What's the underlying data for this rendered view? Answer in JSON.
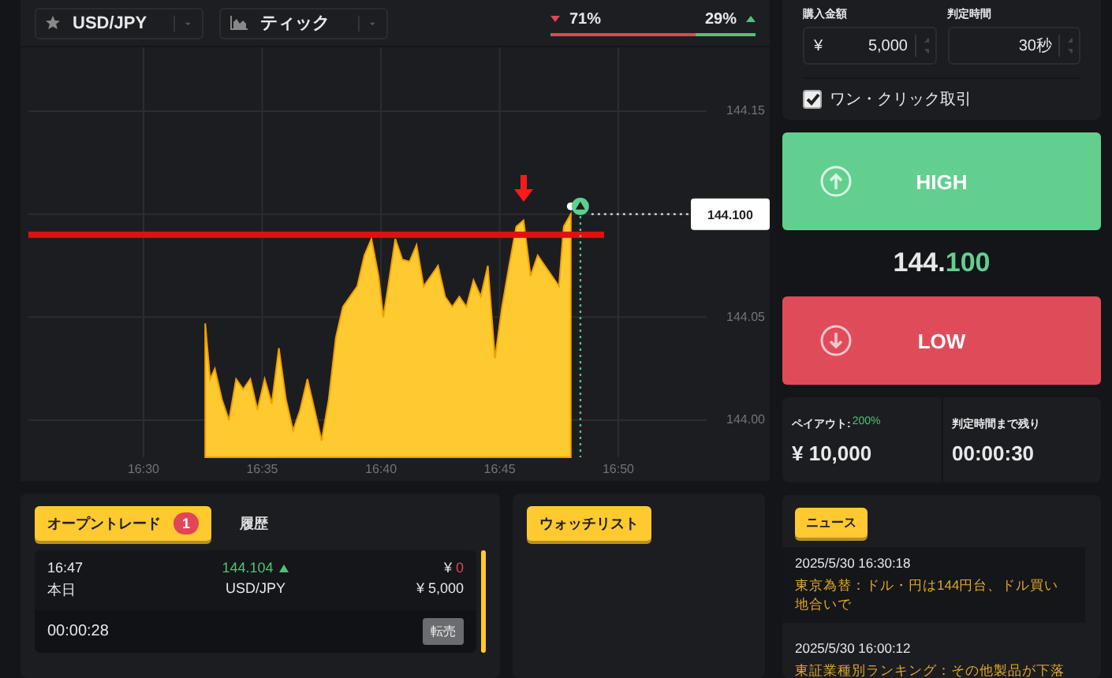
{
  "toolbar": {
    "symbol": "USD/JPY",
    "chart_type": "ティック"
  },
  "sentiment": {
    "down": "71%",
    "up": "29%",
    "level": 0.71
  },
  "chart": {
    "chart_data": {
      "type": "area",
      "grid": true,
      "xlim": [
        16.5,
        16.8333
      ],
      "ylim": [
        143.982,
        144.15
      ],
      "xticks": [
        {
          "value": 16.5,
          "label": "16:30"
        },
        {
          "value": 16.5833,
          "label": "16:35"
        },
        {
          "value": 16.6667,
          "label": "16:40"
        },
        {
          "value": 16.75,
          "label": "16:45"
        },
        {
          "value": 16.8333,
          "label": "16:50"
        }
      ],
      "yticks": [
        {
          "value": 144.0,
          "label": "144.00"
        },
        {
          "value": 144.05,
          "label": "144.05"
        },
        {
          "value": 144.15,
          "label": "144.15"
        }
      ],
      "x": [
        16.5433,
        16.5467,
        16.55,
        16.555,
        16.56,
        16.565,
        16.57,
        16.575,
        16.58,
        16.585,
        16.59,
        16.595,
        16.6,
        16.605,
        16.61,
        16.615,
        16.62,
        16.625,
        16.63,
        16.635,
        16.64,
        16.645,
        16.65,
        16.655,
        16.66,
        16.665,
        16.6683,
        16.6717,
        16.6767,
        16.6817,
        16.6867,
        16.6917,
        16.6967,
        16.7017,
        16.7067,
        16.7117,
        16.7167,
        16.7217,
        16.7267,
        16.7317,
        16.7367,
        16.7417,
        16.7467,
        16.7517,
        16.7567,
        16.7617,
        16.7667,
        16.7717,
        16.7767,
        16.7817,
        16.7867,
        16.7917,
        16.795,
        16.8
      ],
      "series": [
        {
          "color": "#ffc930",
          "values": [
            144.047,
            144.02,
            144.025,
            144.01,
            144.0,
            144.02,
            144.015,
            144.02,
            144.005,
            144.02,
            144.008,
            144.035,
            144.01,
            143.995,
            144.005,
            144.02,
            144.005,
            143.99,
            144.01,
            144.04,
            144.055,
            144.06,
            144.065,
            144.08,
            144.088,
            144.07,
            144.05,
            144.065,
            144.088,
            144.078,
            144.077,
            144.085,
            144.065,
            144.07,
            144.075,
            144.06,
            144.055,
            144.06,
            144.055,
            144.068,
            144.06,
            144.075,
            144.03,
            144.055,
            144.075,
            144.094,
            144.097,
            144.07,
            144.08,
            144.075,
            144.07,
            144.065,
            144.094,
            144.1
          ]
        }
      ],
      "ref_lines": [
        {
          "axis": "y",
          "value": 144.09
        },
        {
          "axis": "x",
          "value": 16.8067
        }
      ],
      "annotations": [
        "144.100"
      ]
    }
  },
  "order_form": {
    "amount_label": "購入金額",
    "currency": "¥",
    "amount": "5,000",
    "time_label": "判定時間",
    "time": "30秒",
    "one_click": {
      "label": "ワン・クリック取引",
      "checked": true
    }
  },
  "high_button": "HIGH",
  "price": {
    "integer": "144.",
    "decimal": "100"
  },
  "low_button": "LOW",
  "payout": {
    "label": "ペイアウト:",
    "rate": "200%",
    "amount": "¥ 10,000"
  },
  "remaining": {
    "label": "判定時間まで残り",
    "time": "00:00:30"
  },
  "trades": {
    "tabs": [
      {
        "label": "オープントレード",
        "badge": "1",
        "selected": true
      },
      {
        "label": "履歴",
        "selected": false
      }
    ],
    "rows": [
      {
        "time": "16:47",
        "price": "144.104",
        "rising": true,
        "pl_currency": "¥",
        "pl": "0",
        "day": "本日",
        "symbol": "USD/JPY",
        "stake": "¥ 5,000",
        "countdown": "00:00:28",
        "action": "転売"
      }
    ]
  },
  "watchlist": {
    "title": "ウォッチリスト"
  },
  "news": {
    "title": "ニュース",
    "items": [
      {
        "time": "2025/5/30 16:30:18",
        "headline": "東京為替：ドル・円は144円台、ドル買い地合いで"
      },
      {
        "time": "2025/5/30 16:00:12",
        "headline": "東証業種別ランキング：その他製品が下落"
      }
    ]
  }
}
